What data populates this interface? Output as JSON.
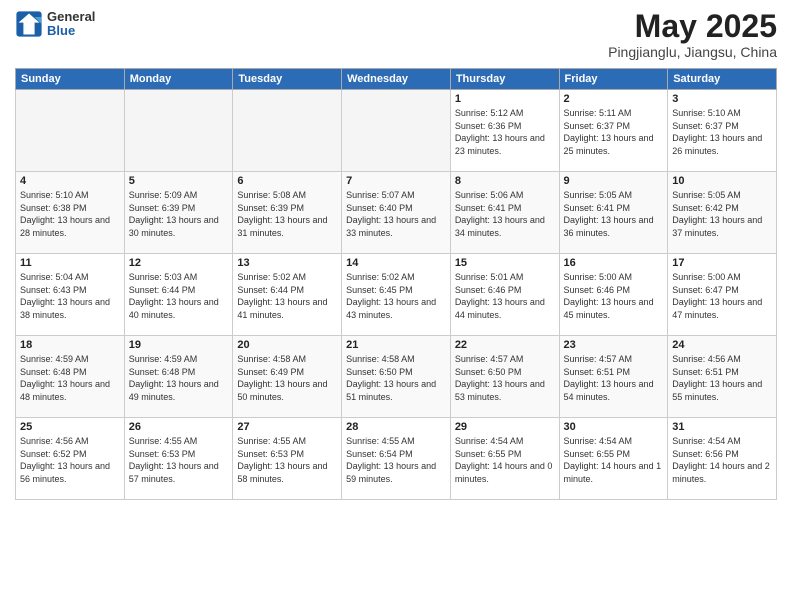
{
  "header": {
    "logo_general": "General",
    "logo_blue": "Blue",
    "title": "May 2025",
    "subtitle": "Pingjianglu, Jiangsu, China"
  },
  "days_of_week": [
    "Sunday",
    "Monday",
    "Tuesday",
    "Wednesday",
    "Thursday",
    "Friday",
    "Saturday"
  ],
  "weeks": [
    [
      {
        "day": "",
        "sunrise": "",
        "sunset": "",
        "daylight": "",
        "empty": true
      },
      {
        "day": "",
        "sunrise": "",
        "sunset": "",
        "daylight": "",
        "empty": true
      },
      {
        "day": "",
        "sunrise": "",
        "sunset": "",
        "daylight": "",
        "empty": true
      },
      {
        "day": "",
        "sunrise": "",
        "sunset": "",
        "daylight": "",
        "empty": true
      },
      {
        "day": "1",
        "sunrise": "Sunrise: 5:12 AM",
        "sunset": "Sunset: 6:36 PM",
        "daylight": "Daylight: 13 hours and 23 minutes.",
        "empty": false
      },
      {
        "day": "2",
        "sunrise": "Sunrise: 5:11 AM",
        "sunset": "Sunset: 6:37 PM",
        "daylight": "Daylight: 13 hours and 25 minutes.",
        "empty": false
      },
      {
        "day": "3",
        "sunrise": "Sunrise: 5:10 AM",
        "sunset": "Sunset: 6:37 PM",
        "daylight": "Daylight: 13 hours and 26 minutes.",
        "empty": false
      }
    ],
    [
      {
        "day": "4",
        "sunrise": "Sunrise: 5:10 AM",
        "sunset": "Sunset: 6:38 PM",
        "daylight": "Daylight: 13 hours and 28 minutes.",
        "empty": false
      },
      {
        "day": "5",
        "sunrise": "Sunrise: 5:09 AM",
        "sunset": "Sunset: 6:39 PM",
        "daylight": "Daylight: 13 hours and 30 minutes.",
        "empty": false
      },
      {
        "day": "6",
        "sunrise": "Sunrise: 5:08 AM",
        "sunset": "Sunset: 6:39 PM",
        "daylight": "Daylight: 13 hours and 31 minutes.",
        "empty": false
      },
      {
        "day": "7",
        "sunrise": "Sunrise: 5:07 AM",
        "sunset": "Sunset: 6:40 PM",
        "daylight": "Daylight: 13 hours and 33 minutes.",
        "empty": false
      },
      {
        "day": "8",
        "sunrise": "Sunrise: 5:06 AM",
        "sunset": "Sunset: 6:41 PM",
        "daylight": "Daylight: 13 hours and 34 minutes.",
        "empty": false
      },
      {
        "day": "9",
        "sunrise": "Sunrise: 5:05 AM",
        "sunset": "Sunset: 6:41 PM",
        "daylight": "Daylight: 13 hours and 36 minutes.",
        "empty": false
      },
      {
        "day": "10",
        "sunrise": "Sunrise: 5:05 AM",
        "sunset": "Sunset: 6:42 PM",
        "daylight": "Daylight: 13 hours and 37 minutes.",
        "empty": false
      }
    ],
    [
      {
        "day": "11",
        "sunrise": "Sunrise: 5:04 AM",
        "sunset": "Sunset: 6:43 PM",
        "daylight": "Daylight: 13 hours and 38 minutes.",
        "empty": false
      },
      {
        "day": "12",
        "sunrise": "Sunrise: 5:03 AM",
        "sunset": "Sunset: 6:44 PM",
        "daylight": "Daylight: 13 hours and 40 minutes.",
        "empty": false
      },
      {
        "day": "13",
        "sunrise": "Sunrise: 5:02 AM",
        "sunset": "Sunset: 6:44 PM",
        "daylight": "Daylight: 13 hours and 41 minutes.",
        "empty": false
      },
      {
        "day": "14",
        "sunrise": "Sunrise: 5:02 AM",
        "sunset": "Sunset: 6:45 PM",
        "daylight": "Daylight: 13 hours and 43 minutes.",
        "empty": false
      },
      {
        "day": "15",
        "sunrise": "Sunrise: 5:01 AM",
        "sunset": "Sunset: 6:46 PM",
        "daylight": "Daylight: 13 hours and 44 minutes.",
        "empty": false
      },
      {
        "day": "16",
        "sunrise": "Sunrise: 5:00 AM",
        "sunset": "Sunset: 6:46 PM",
        "daylight": "Daylight: 13 hours and 45 minutes.",
        "empty": false
      },
      {
        "day": "17",
        "sunrise": "Sunrise: 5:00 AM",
        "sunset": "Sunset: 6:47 PM",
        "daylight": "Daylight: 13 hours and 47 minutes.",
        "empty": false
      }
    ],
    [
      {
        "day": "18",
        "sunrise": "Sunrise: 4:59 AM",
        "sunset": "Sunset: 6:48 PM",
        "daylight": "Daylight: 13 hours and 48 minutes.",
        "empty": false
      },
      {
        "day": "19",
        "sunrise": "Sunrise: 4:59 AM",
        "sunset": "Sunset: 6:48 PM",
        "daylight": "Daylight: 13 hours and 49 minutes.",
        "empty": false
      },
      {
        "day": "20",
        "sunrise": "Sunrise: 4:58 AM",
        "sunset": "Sunset: 6:49 PM",
        "daylight": "Daylight: 13 hours and 50 minutes.",
        "empty": false
      },
      {
        "day": "21",
        "sunrise": "Sunrise: 4:58 AM",
        "sunset": "Sunset: 6:50 PM",
        "daylight": "Daylight: 13 hours and 51 minutes.",
        "empty": false
      },
      {
        "day": "22",
        "sunrise": "Sunrise: 4:57 AM",
        "sunset": "Sunset: 6:50 PM",
        "daylight": "Daylight: 13 hours and 53 minutes.",
        "empty": false
      },
      {
        "day": "23",
        "sunrise": "Sunrise: 4:57 AM",
        "sunset": "Sunset: 6:51 PM",
        "daylight": "Daylight: 13 hours and 54 minutes.",
        "empty": false
      },
      {
        "day": "24",
        "sunrise": "Sunrise: 4:56 AM",
        "sunset": "Sunset: 6:51 PM",
        "daylight": "Daylight: 13 hours and 55 minutes.",
        "empty": false
      }
    ],
    [
      {
        "day": "25",
        "sunrise": "Sunrise: 4:56 AM",
        "sunset": "Sunset: 6:52 PM",
        "daylight": "Daylight: 13 hours and 56 minutes.",
        "empty": false
      },
      {
        "day": "26",
        "sunrise": "Sunrise: 4:55 AM",
        "sunset": "Sunset: 6:53 PM",
        "daylight": "Daylight: 13 hours and 57 minutes.",
        "empty": false
      },
      {
        "day": "27",
        "sunrise": "Sunrise: 4:55 AM",
        "sunset": "Sunset: 6:53 PM",
        "daylight": "Daylight: 13 hours and 58 minutes.",
        "empty": false
      },
      {
        "day": "28",
        "sunrise": "Sunrise: 4:55 AM",
        "sunset": "Sunset: 6:54 PM",
        "daylight": "Daylight: 13 hours and 59 minutes.",
        "empty": false
      },
      {
        "day": "29",
        "sunrise": "Sunrise: 4:54 AM",
        "sunset": "Sunset: 6:55 PM",
        "daylight": "Daylight: 14 hours and 0 minutes.",
        "empty": false
      },
      {
        "day": "30",
        "sunrise": "Sunrise: 4:54 AM",
        "sunset": "Sunset: 6:55 PM",
        "daylight": "Daylight: 14 hours and 1 minute.",
        "empty": false
      },
      {
        "day": "31",
        "sunrise": "Sunrise: 4:54 AM",
        "sunset": "Sunset: 6:56 PM",
        "daylight": "Daylight: 14 hours and 2 minutes.",
        "empty": false
      }
    ]
  ]
}
